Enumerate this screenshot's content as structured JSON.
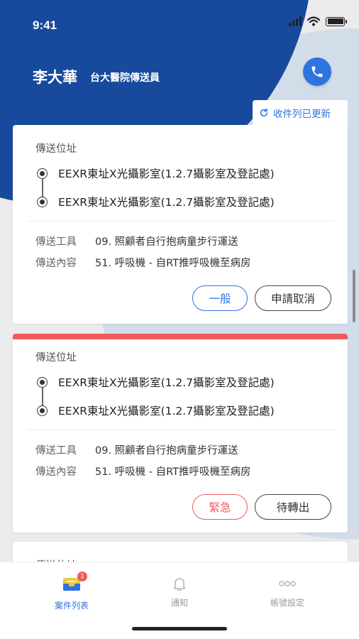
{
  "status": {
    "time": "9:41"
  },
  "header": {
    "name": "李大華",
    "role": "台大醫院傳送員"
  },
  "refresh": {
    "label": "收件列已更新"
  },
  "cards": [
    {
      "section_title": "傳送位址",
      "from": "EEXR東址X光攝影室(1.2.7攝影室及登記處)",
      "to": "EEXR東址X光攝影室(1.2.7攝影室及登記處)",
      "tool_label": "傳送工具",
      "tool_value": "09. 照顧者自行抱病童步行運送",
      "content_label": "傳送內容",
      "content_value": "51. 呼吸機 - 自RT推呼吸機至病房",
      "priority": "一般",
      "action": "申請取消"
    },
    {
      "section_title": "傳送位址",
      "from": "EEXR東址X光攝影室(1.2.7攝影室及登記處)",
      "to": "EEXR東址X光攝影室(1.2.7攝影室及登記處)",
      "tool_label": "傳送工具",
      "tool_value": "09. 照顧者自行抱病童步行運送",
      "content_label": "傳送內容",
      "content_value": "51. 呼吸機 - 自RT推呼吸機至病房",
      "priority": "緊急",
      "action": "待轉出"
    },
    {
      "section_title": "傳送位址"
    }
  ],
  "tabs": [
    {
      "label": "案件列表",
      "icon": "inbox-icon",
      "badge": "1",
      "active": true
    },
    {
      "label": "通知",
      "icon": "bell-icon"
    },
    {
      "label": "帳號設定",
      "icon": "more-icon"
    }
  ],
  "colors": {
    "primary": "#2f73e0",
    "header_blue": "#174a9c",
    "urgent": "#ef5b5b"
  }
}
